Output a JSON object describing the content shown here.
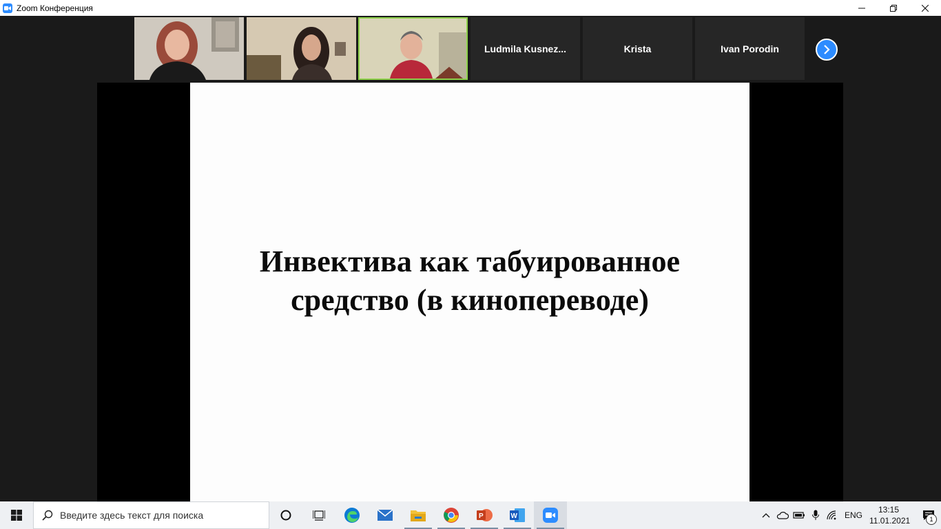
{
  "window": {
    "title": "Zoom Конференция",
    "controls": [
      "minimize",
      "restore",
      "close"
    ]
  },
  "gallery": {
    "video_tiles": [
      {
        "kind": "video",
        "active": false
      },
      {
        "kind": "video",
        "active": false
      },
      {
        "kind": "video",
        "active": true
      }
    ],
    "name_tiles": [
      "Ludmila  Kusnez...",
      "Krista",
      "Ivan Porodin"
    ],
    "next_icon": "chevron-right-icon",
    "active_speaker_color": "#8ed14a",
    "accent": "#2d8cff"
  },
  "shared_screen": {
    "slide_title_line1": "Инвектива как табуированное",
    "slide_title_line2": "средство (в кинопереводе)"
  },
  "taskbar": {
    "search_placeholder": "Введите здесь текст для поиска",
    "apps": [
      "cortana-icon",
      "task-view-icon",
      "edge-icon",
      "mail-icon",
      "file-explorer-icon",
      "chrome-icon",
      "powerpoint-icon",
      "word-icon",
      "zoom-icon"
    ],
    "language": "ENG",
    "time": "13:15",
    "date": "11.01.2021",
    "notification_count": "1"
  }
}
